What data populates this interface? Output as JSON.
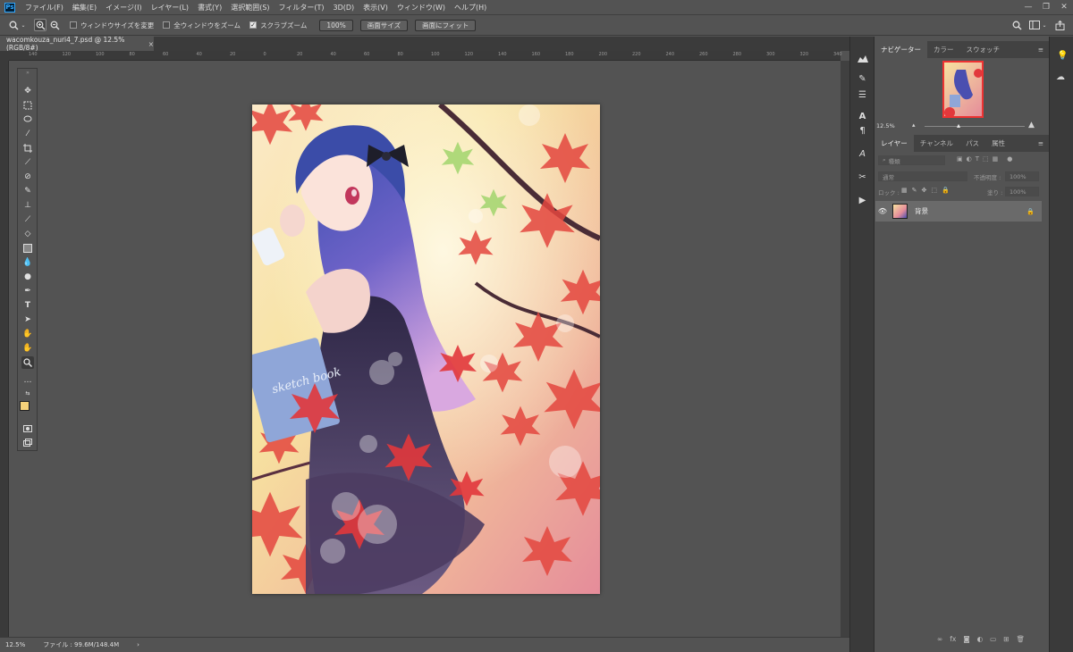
{
  "app": {
    "logo": "Ps",
    "minimize": "—",
    "restore": "❐",
    "close": "✕"
  },
  "menu": [
    "ファイル(F)",
    "編集(E)",
    "イメージ(I)",
    "レイヤー(L)",
    "書式(Y)",
    "選択範囲(S)",
    "フィルター(T)",
    "3D(D)",
    "表示(V)",
    "ウィンドウ(W)",
    "ヘルプ(H)"
  ],
  "options": {
    "resize_windows": "ウィンドウサイズを変更",
    "zoom_all": "全ウィンドウをズーム",
    "scrubby_zoom": "スクラブズーム",
    "scrubby_checked": true,
    "btn_100": "100%",
    "btn_fit_screen": "画面サイズ",
    "btn_fill_screen": "画面にフィット"
  },
  "document": {
    "tab_title": "wacomkouza_nuri4_7.psd @ 12.5% (RGB/8#)",
    "close": "×"
  },
  "ruler_top": [
    "140",
    "120",
    "100",
    "80",
    "60",
    "40",
    "20",
    "0",
    "20",
    "40",
    "60",
    "80",
    "100",
    "120",
    "140",
    "160",
    "180",
    "200",
    "220",
    "240",
    "260",
    "280",
    "300",
    "320",
    "340"
  ],
  "status": {
    "zoom": "12.5%",
    "file_info": "ファイル : 99.6M/148.4M",
    "arrow": "›"
  },
  "navigator": {
    "tabs": [
      "ナビゲーター",
      "カラー",
      "スウォッチ"
    ],
    "zoom": "12.5%"
  },
  "layers": {
    "tabs": [
      "レイヤー",
      "チャンネル",
      "パス",
      "属性"
    ],
    "filter_label": "種類",
    "blend_mode": "通常",
    "opacity_label": "不透明度 :",
    "opacity_value": "100%",
    "lock_label": "ロック :",
    "fill_label": "塗り :",
    "fill_value": "100%",
    "items": [
      {
        "name": "背景",
        "visible": true,
        "locked": true
      }
    ]
  },
  "artwork_text": {
    "sketchbook": "sketch book"
  },
  "colors": {
    "accent": "#31a8ff",
    "foreground": "#f6d27a",
    "background": "#ffffff"
  }
}
